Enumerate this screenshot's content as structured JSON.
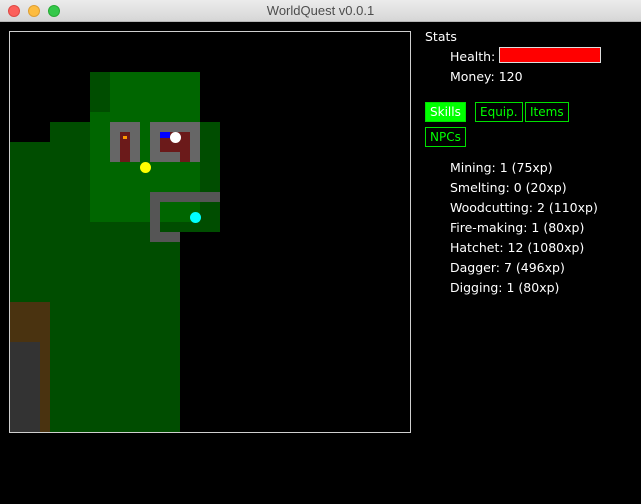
{
  "window": {
    "title": "WorldQuest v0.0.1"
  },
  "stats": {
    "title": "Stats",
    "health_label": "Health:",
    "health_fraction": 1.0,
    "health_color": "#ff0000",
    "money_label": "Money: 120"
  },
  "tabs": [
    {
      "label": "Skills",
      "active": true
    },
    {
      "label": "Equip.",
      "active": false
    },
    {
      "label": "Items",
      "active": false
    },
    {
      "label": "NPCs",
      "active": false
    }
  ],
  "skills": [
    "Mining: 1 (75xp)",
    "Smelting: 0 (20xp)",
    "Woodcutting: 2 (110xp)",
    "Fire-making: 1 (80xp)",
    "Hatchet: 12 (1080xp)",
    "Dagger: 7 (496xp)",
    "Digging: 1 (80xp)"
  ],
  "colors": {
    "accent_green": "#00ff00",
    "forest": "#004d00",
    "clearing": "#006600",
    "wall": "#666666",
    "house_floor": "#6b1a1a",
    "dirt": "#4a3310",
    "stone": "#333333"
  },
  "entities": [
    {
      "name": "player",
      "color": "#ffffff"
    },
    {
      "name": "npc-yellow",
      "color": "#ffff00"
    },
    {
      "name": "npc-cyan",
      "color": "#00ffff"
    }
  ]
}
